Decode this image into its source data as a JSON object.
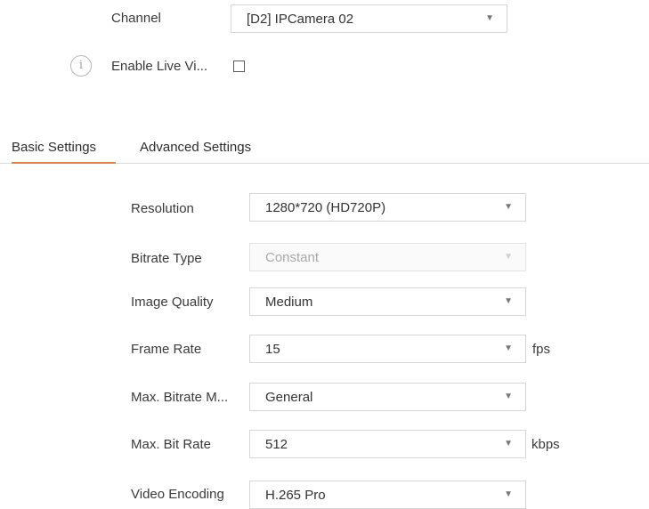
{
  "channel": {
    "label": "Channel",
    "value": "[D2] IPCamera 02"
  },
  "live_view": {
    "label": "Enable Live Vi...",
    "info_icon": "info-icon",
    "checked": false
  },
  "tabs": [
    {
      "label": "Basic Settings",
      "active": true
    },
    {
      "label": "Advanced Settings",
      "active": false
    }
  ],
  "colors": {
    "accent": "#e9803f"
  },
  "settings": {
    "resolution": {
      "label": "Resolution",
      "value": "1280*720 (HD720P)"
    },
    "bitrate_type": {
      "label": "Bitrate Type",
      "value": "Constant",
      "disabled": true
    },
    "image_quality": {
      "label": "Image Quality",
      "value": "Medium"
    },
    "frame_rate": {
      "label": "Frame Rate",
      "value": "15",
      "unit": "fps"
    },
    "max_bitrate_mode": {
      "label": "Max. Bitrate M...",
      "value": "General"
    },
    "max_bit_rate": {
      "label": "Max. Bit Rate",
      "value": "512",
      "unit": "kbps"
    },
    "video_encoding": {
      "label": "Video Encoding",
      "value": "H.265 Pro"
    }
  }
}
